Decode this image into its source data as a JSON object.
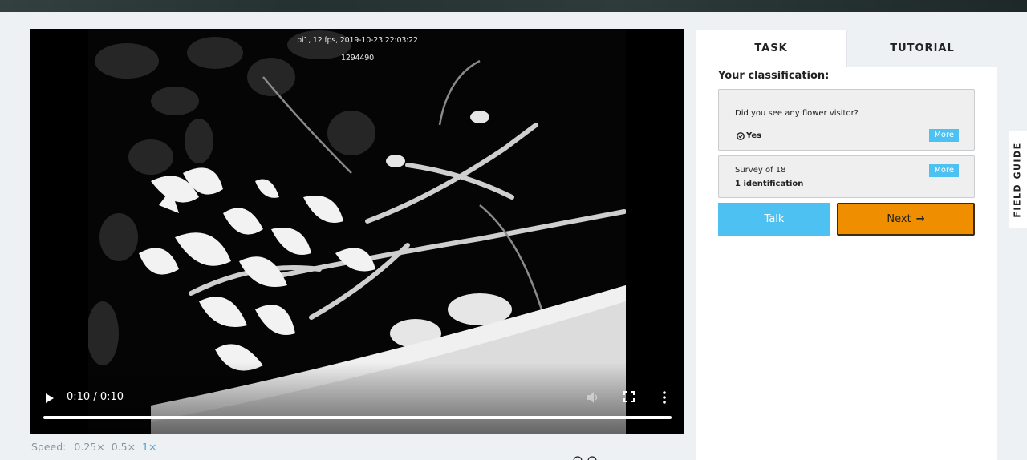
{
  "video": {
    "overlay_line1": "pi1, 12 fps, 2019-10-23 22:03:22",
    "overlay_line2": "1294490",
    "time": "0:10 / 0:10",
    "progress": 1.0
  },
  "speed": {
    "label": "Speed:",
    "options": [
      "0.25×",
      "0.5×",
      "1×"
    ],
    "selected": "1×"
  },
  "tabs": [
    {
      "label": "TASK",
      "active": true
    },
    {
      "label": "TUTORIAL",
      "active": false
    }
  ],
  "classification": {
    "heading": "Your classification:",
    "question": {
      "text": "Did you see any flower visitor?",
      "answer": "Yes",
      "more_label": "More"
    },
    "survey": {
      "title": "Survey of 18",
      "subtitle": "1 identification",
      "more_label": "More"
    }
  },
  "buttons": {
    "talk": "Talk",
    "next": "Next"
  },
  "field_guide": "FIELD GUIDE",
  "colors": {
    "accent_blue": "#4cc1f2",
    "next_orange": "#ef8f00",
    "speed_active": "#4aa3d8"
  },
  "icons": [
    "play-icon",
    "volume-icon",
    "fullscreen-icon",
    "more-vert-icon",
    "check-circle-icon",
    "arrow-right-icon"
  ]
}
